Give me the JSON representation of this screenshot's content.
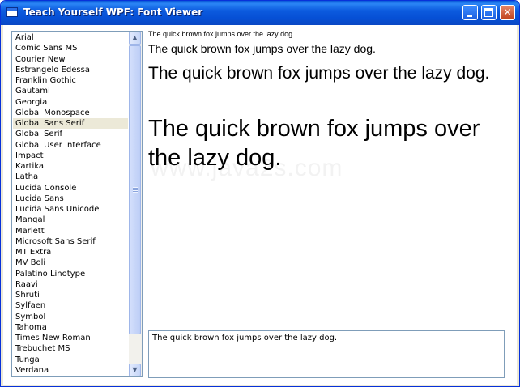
{
  "window": {
    "title": "Teach Yourself WPF: Font Viewer"
  },
  "font_list": {
    "items": [
      "Arial",
      "Comic Sans MS",
      "Courier New",
      "Estrangelo Edessa",
      "Franklin Gothic",
      "Gautami",
      "Georgia",
      "Global Monospace",
      "Global Sans Serif",
      "Global Serif",
      "Global User Interface",
      "Impact",
      "Kartika",
      "Latha",
      "Lucida Console",
      "Lucida Sans",
      "Lucida Sans Unicode",
      "Mangal",
      "Marlett",
      "Microsoft Sans Serif",
      "MT Extra",
      "MV Boli",
      "Palatino Linotype",
      "Raavi",
      "Shruti",
      "Sylfaen",
      "Symbol",
      "Tahoma",
      "Times New Roman",
      "Trebuchet MS",
      "Tunga",
      "Verdana"
    ],
    "selected": "Global Sans Serif"
  },
  "preview": {
    "sample_small": "The quick brown fox jumps over the lazy dog.",
    "sample_medium": "The quick brown fox jumps over the lazy dog.",
    "sample_large": "The quick brown fox jumps over the lazy dog.",
    "sample_xlarge": "The quick brown fox jumps over the lazy dog."
  },
  "watermark": "www.java2s.com",
  "sample_input": {
    "value": "The quick brown fox jumps over the lazy dog."
  },
  "icons": {
    "app": "window-icon",
    "minimize": "minimize-icon",
    "maximize": "maximize-icon",
    "close": "close-icon",
    "scroll_up": "chevron-up-icon",
    "scroll_down": "chevron-down-icon"
  }
}
